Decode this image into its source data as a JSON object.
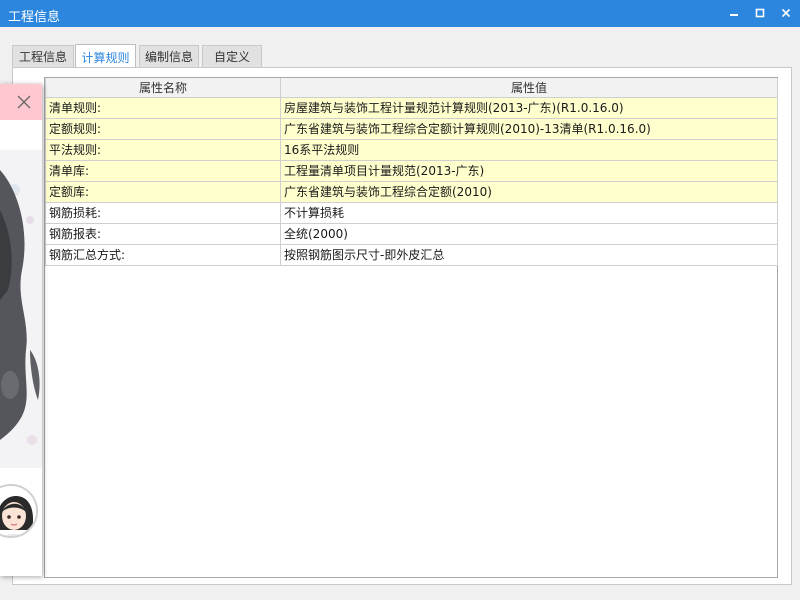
{
  "window": {
    "title": "工程信息"
  },
  "tabs": [
    {
      "label": "工程信息"
    },
    {
      "label": "计算规则"
    },
    {
      "label": "编制信息"
    },
    {
      "label": "自定义"
    }
  ],
  "grid": {
    "headers": [
      "属性名称",
      "属性值"
    ],
    "rows": [
      {
        "name": "清单规则:",
        "value": "房屋建筑与装饰工程计量规范计算规则(2013-广东)(R1.0.16.0)"
      },
      {
        "name": "定额规则:",
        "value": "广东省建筑与装饰工程综合定额计算规则(2010)-13清单(R1.0.16.0)"
      },
      {
        "name": "平法规则:",
        "value": "16系平法规则"
      },
      {
        "name": "清单库:",
        "value": "工程量清单项目计量规范(2013-广东)"
      },
      {
        "name": "定额库:",
        "value": "广东省建筑与装饰工程综合定额(2010)"
      },
      {
        "name": "钢筋损耗:",
        "value": "不计算损耗"
      },
      {
        "name": "钢筋报表:",
        "value": "全统(2000)"
      },
      {
        "name": "钢筋汇总方式:",
        "value": "按照钢筋图示尺寸-即外皮汇总"
      }
    ]
  },
  "colors": {
    "titlebar": "#2c86de",
    "active_tab_text": "#2c86de",
    "highlight_row": "#ffffcd",
    "popup_header": "#ffc7cf"
  },
  "icons": {
    "minimize": "minimize-icon",
    "maximize": "maximize-icon",
    "close": "close-icon",
    "popup_close": "close-icon"
  }
}
